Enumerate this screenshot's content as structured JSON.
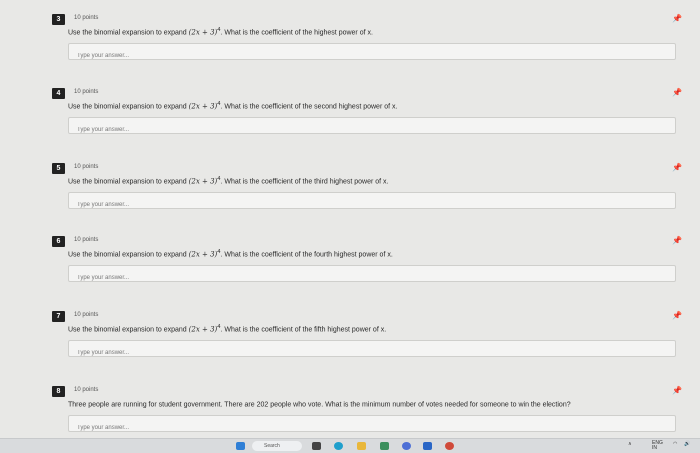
{
  "questions": [
    {
      "num": "3",
      "points": "10 points",
      "prefix": "Use the binomial expansion to expand ",
      "expr": "(2x + 3)",
      "exp": "4",
      "suffix": ". What is the coefficient of the highest power of x.",
      "placeholder": "Type your answer..."
    },
    {
      "num": "4",
      "points": "10 points",
      "prefix": "Use the binomial expansion to expand ",
      "expr": "(2x + 3)",
      "exp": "4",
      "suffix": ". What is the coefficient of the second highest power of x.",
      "placeholder": "Type your answer..."
    },
    {
      "num": "5",
      "points": "10 points",
      "prefix": "Use the binomial expansion to expand ",
      "expr": "(2x + 3)",
      "exp": "4",
      "suffix": ". What is the coefficient of the third highest power of x.",
      "placeholder": "Type your answer..."
    },
    {
      "num": "6",
      "points": "10 points",
      "prefix": "Use the binomial expansion to expand ",
      "expr": "(2x + 3)",
      "exp": "4",
      "suffix": ". What is the coefficient of the fourth highest power of x.",
      "placeholder": "Type your answer..."
    },
    {
      "num": "7",
      "points": "10 points",
      "prefix": "Use the binomial expansion to expand ",
      "expr": "(2x + 3)",
      "exp": "4",
      "suffix": ". What is the coefficient of the fifth highest power of x.",
      "placeholder": "Type your answer..."
    },
    {
      "num": "8",
      "points": "10 points",
      "prefix": "Three people are running for student government. There are 202 people who vote. What is the minimum number of votes needed for someone to win the election?",
      "expr": "",
      "exp": "",
      "suffix": "",
      "placeholder": "Type your answer..."
    }
  ],
  "pin_icon": "pin-icon",
  "taskbar": {
    "search_label": "Search",
    "lang": "ENG",
    "lang_region": "IN"
  },
  "colors": {
    "number_badge": "#222222",
    "page_background": "#e8e8e6",
    "answer_background": "#f4f4f3"
  }
}
